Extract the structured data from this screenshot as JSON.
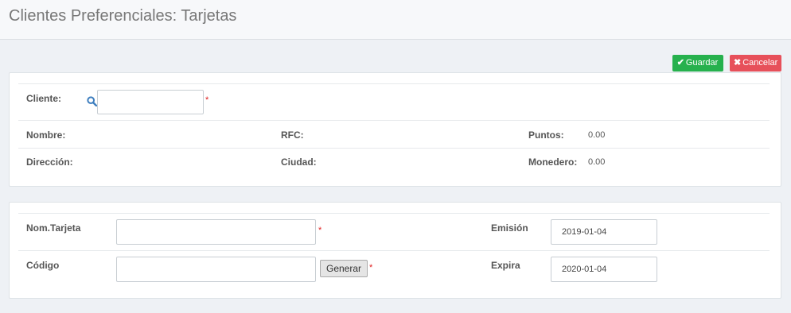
{
  "header": {
    "title": "Clientes Preferenciales: Tarjetas"
  },
  "toolbar": {
    "save_icon": "✔",
    "save_label": "Guardar",
    "cancel_icon": "✖",
    "cancel_label": "Cancelar"
  },
  "client": {
    "cliente_label": "Cliente:",
    "cliente_value": "",
    "nombre_label": "Nombre:",
    "rfc_label": "RFC:",
    "puntos_label": "Puntos:",
    "puntos_value": "0.00",
    "direccion_label": "Dirección:",
    "ciudad_label": "Ciudad:",
    "monedero_label": "Monedero:",
    "monedero_value": "0.00"
  },
  "card": {
    "nom_tarjeta_label": "Nom.Tarjeta",
    "nom_tarjeta_value": "",
    "codigo_label": "Código",
    "codigo_value": "",
    "generar_label": "Generar",
    "emision_label": "Emisión",
    "emision_value": "2019-01-04",
    "expira_label": "Expira",
    "expira_value": "2020-01-04"
  },
  "required_mark": "*",
  "colors": {
    "save": "#26b14d",
    "cancel": "#e7505a",
    "icon": "#3f7fbf",
    "required": "#e02020"
  }
}
